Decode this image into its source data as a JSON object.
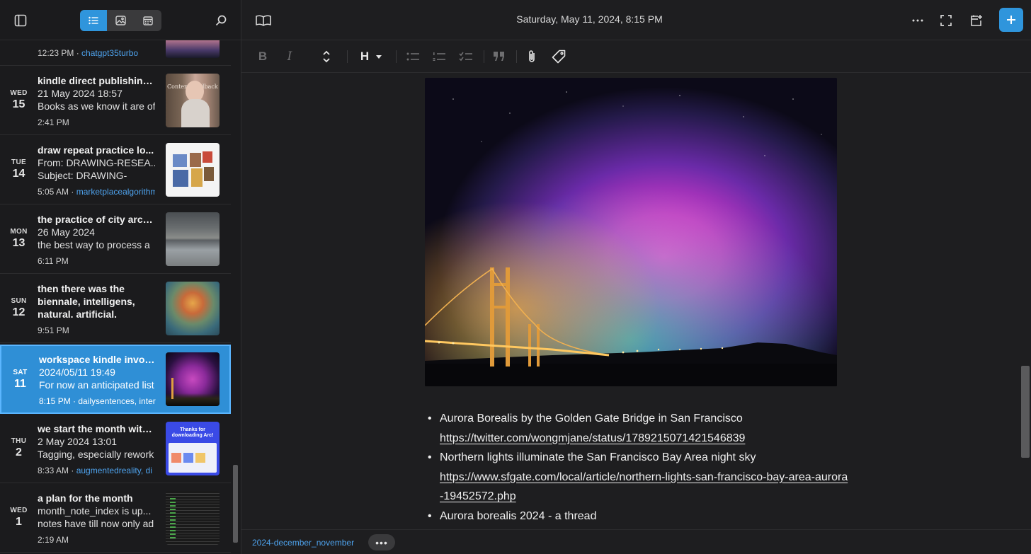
{
  "sidebar": {
    "view_modes": [
      "list-view-icon",
      "gallery-view-icon",
      "calendar-view-icon"
    ],
    "partial_note": {
      "meta_time": "12:23 PM",
      "meta_tags": "chatgpt35turbo"
    },
    "notes": [
      {
        "dow": "WED",
        "dom": "15",
        "title": "kindle direct publishing ...",
        "line2": "21 May 2024 18:57",
        "line3": "Books as we know it are of",
        "meta_time": "2:41 PM",
        "meta_tags": ""
      },
      {
        "dow": "TUE",
        "dom": "14",
        "title": "draw repeat practice lo...",
        "line2": "From: DRAWING-RESEA...",
        "line3": "Subject: DRAWING-",
        "meta_time": "5:05 AM",
        "meta_tags": "marketplacealgorithm"
      },
      {
        "dow": "MON",
        "dom": "13",
        "title": "the practice of city arch...",
        "line2": "26 May 2024",
        "line3": "the best way to process a",
        "meta_time": "6:11 PM",
        "meta_tags": ""
      },
      {
        "dow": "SUN",
        "dom": "12",
        "title": "then there was the biennale, intelligens, natural. artificial.",
        "line2": "",
        "line3": "",
        "meta_time": "9:51 PM",
        "meta_tags": ""
      },
      {
        "dow": "SAT",
        "dom": "11",
        "title": "workspace kindle invoice",
        "line2": "2024/05/11 19:49",
        "line3": "For now an anticipated list",
        "meta_time": "8:15 PM",
        "meta_tags": "dailysentences, inter"
      },
      {
        "dow": "THU",
        "dom": "2",
        "title": "we start the month with...",
        "line2": "2 May 2024 13:01",
        "line3": "Tagging, especially rework",
        "meta_time": "8:33 AM",
        "meta_tags": "augmentedreality, di"
      },
      {
        "dow": "WED",
        "dom": "1",
        "title": "a plan for the month",
        "line2": "month_note_index is up...",
        "line3": "notes have till now only ad",
        "meta_time": "2:19 AM",
        "meta_tags": ""
      }
    ],
    "thumb_texts": {
      "kindle_overlay": "Content feedback",
      "arc_title": "Thanks for downloading Arc!"
    }
  },
  "editor": {
    "date": "Saturday, May 11, 2024, 8:15 PM",
    "toolbar": {
      "bold": "B",
      "italic": "I",
      "heading": "H"
    },
    "bullets": [
      {
        "text": "Aurora Borealis by the Golden Gate Bridge in San Francisco",
        "link": "https://twitter.com/wongmjane/status/1789215071421546839"
      },
      {
        "text": "Northern lights illuminate the San Francisco Bay Area night sky",
        "link": "https://www.sfgate.com/local/article/northern-lights-san-francisco-bay-area-aurora-19452572.php"
      },
      {
        "text": "Aurora borealis 2024 - a thread",
        "link": ""
      }
    ],
    "footer": {
      "notebook": "2024-december_november",
      "more": "•••"
    }
  },
  "colors": {
    "accent": "#2f95dc",
    "link": "#4ea3ee",
    "background": "#1e1e20"
  }
}
